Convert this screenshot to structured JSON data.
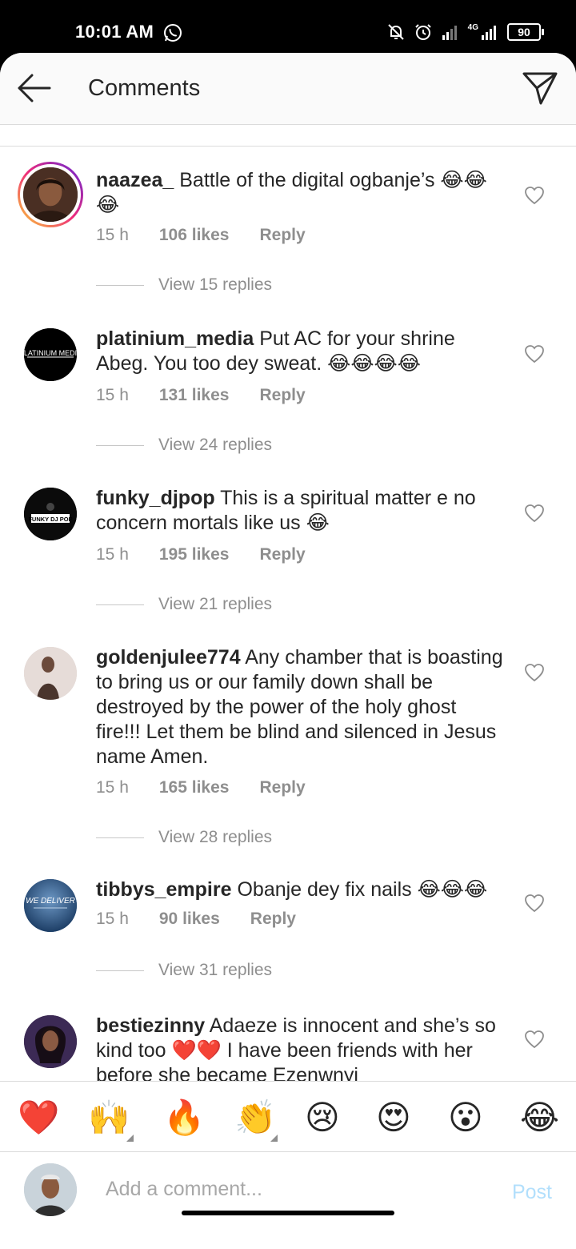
{
  "status_bar": {
    "time": "10:01 AM",
    "network": "4G",
    "battery": "90"
  },
  "header": {
    "title": "Comments",
    "back_icon": "arrow-left-icon",
    "send_icon": "paper-plane-icon"
  },
  "comments": [
    {
      "username": "naazea_",
      "text": "Battle of the digital ogbanje’s 😂😂😂",
      "time": "15 h",
      "likes": "106 likes",
      "reply": "Reply",
      "view_replies": "View 15 replies"
    },
    {
      "username": "platinium_media",
      "text": "Put AC for your shrine Abeg. You too dey sweat. 😂😂😂😂",
      "time": "15 h",
      "likes": "131 likes",
      "reply": "Reply",
      "view_replies": "View 24 replies",
      "avatar_text": "PLATINIUM MEDIA"
    },
    {
      "username": "funky_djpop",
      "text": "This is a spiritual matter e no concern mortals like us 😂",
      "time": "15 h",
      "likes": "195 likes",
      "reply": "Reply",
      "view_replies": "View 21 replies",
      "avatar_text": "FUNKY DJ POP"
    },
    {
      "username": "goldenjulee774",
      "text": "Any chamber that is boasting to bring us or our family down shall be destroyed by the power of the holy ghost fire!!! Let them be blind and silenced in Jesus name Amen.",
      "time": "15 h",
      "likes": "165 likes",
      "reply": "Reply",
      "view_replies": "View 28 replies"
    },
    {
      "username": "tibbys_empire",
      "text": "Obanje dey fix nails 😂😂😂",
      "time": "15 h",
      "likes": "90 likes",
      "reply": "Reply",
      "view_replies": "View 31 replies",
      "avatar_text": "WE DELIVER"
    },
    {
      "username": "bestiezinny",
      "text": "Adaeze is innocent and she’s so kind too ❤️❤️ I have been friends with her before she became Ezenwnyi"
    }
  ],
  "emoji_bar": [
    "❤️",
    "🙌",
    "🔥",
    "👏",
    "😢",
    "😍",
    "😮",
    "😂"
  ],
  "input": {
    "placeholder": "Add a comment...",
    "post_label": "Post"
  }
}
